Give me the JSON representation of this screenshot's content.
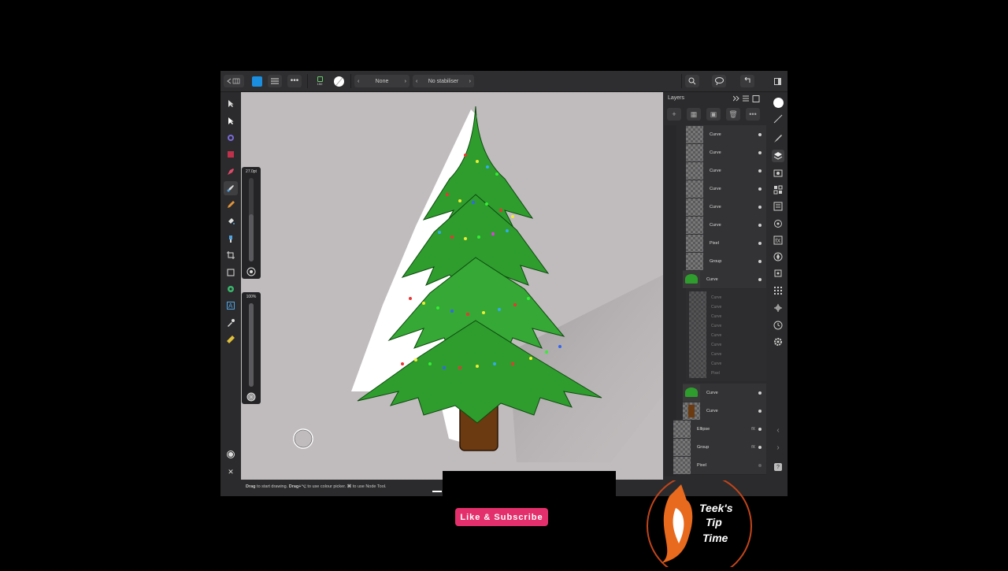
{
  "toolbar": {
    "brush_size_label": "150",
    "blend_mode": "None",
    "stabiliser": "No stabiliser"
  },
  "left_sliders": {
    "width_value": "27.0pt",
    "opacity_value": "100%"
  },
  "status_bar": {
    "hint_bold_1": "Drag",
    "hint_1": " to start drawing. ",
    "hint_bold_2": "Drag+⌥",
    "hint_2": " to use colour picker. ",
    "hint_bold_3": "⌘",
    "hint_3": " to use Node Tool."
  },
  "layers_panel": {
    "title": "Layers",
    "rows": [
      {
        "name": "Curve"
      },
      {
        "name": "Curve"
      },
      {
        "name": "Curve"
      },
      {
        "name": "Curve"
      },
      {
        "name": "Curve"
      },
      {
        "name": "Curve"
      },
      {
        "name": "Pixel"
      },
      {
        "name": "Group"
      },
      {
        "name": "Curve"
      },
      {
        "name": "Curve"
      },
      {
        "name": "Curve"
      },
      {
        "name": "Ellipse"
      },
      {
        "name": "Group"
      },
      {
        "name": "Pixel"
      }
    ],
    "faded_rows": [
      "Curve",
      "Curve",
      "Curve",
      "Curve",
      "Curve",
      "Curve",
      "Curve",
      "Curve",
      "Pixel"
    ],
    "fx_label": "fX"
  },
  "overlay": {
    "subscribe_text": "Like & Subscribe",
    "logo_text_1": "Teek's",
    "logo_text_2": "Tip",
    "logo_text_3": "Time"
  },
  "colors": {
    "tree_green": "#2f9e2f",
    "trunk_brown": "#6b3a10",
    "canvas_bg": "#c0bcbd",
    "subscribe_pink": "#e3306c"
  }
}
